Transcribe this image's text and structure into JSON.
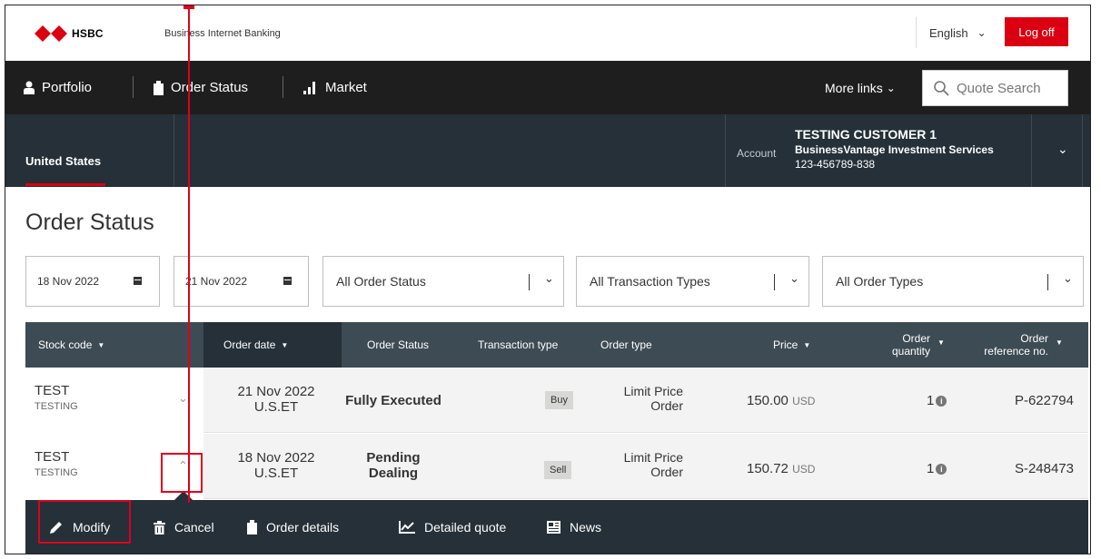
{
  "header": {
    "brand": "HSBC",
    "app_title": "Business Internet Banking",
    "language": "English",
    "logoff_label": "Log off"
  },
  "nav": {
    "items": [
      {
        "label": "Portfolio",
        "icon": "person-icon"
      },
      {
        "label": "Order Status",
        "icon": "clipboard-icon"
      },
      {
        "label": "Market",
        "icon": "bar-chart-icon"
      }
    ],
    "more_links": "More links",
    "quote_search_placeholder": "Quote Search"
  },
  "account": {
    "market_tab": "United States",
    "label": "Account",
    "customer": "TESTING CUSTOMER 1",
    "service": "BusinessVantage Investment Services",
    "number": "123-456789-838"
  },
  "page": {
    "title": "Order Status"
  },
  "filters": {
    "from_date": "18 Nov 2022",
    "to_date": "21 Nov 2022",
    "order_status": "All Order Status",
    "transaction_types": "All Transaction Types",
    "order_types": "All Order Types"
  },
  "table": {
    "headers": {
      "stock_code": "Stock code",
      "order_date": "Order date",
      "order_status": "Order Status",
      "transaction_type": "Transaction type",
      "order_type": "Order type",
      "price": "Price",
      "order_quantity_1": "Order",
      "order_quantity_2": "quantity",
      "order_ref_1": "Order",
      "order_ref_2": "reference no."
    },
    "rows": [
      {
        "stock_code": "TEST",
        "stock_name": "TESTING",
        "date_line1": "21 Nov 2022",
        "date_line2": "U.S.ET",
        "status_line1": "Fully Executed",
        "status_line2": "",
        "transaction": "Buy",
        "type_line1": "Limit Price",
        "type_line2": "Order",
        "price": "150.00",
        "currency": "USD",
        "quantity": "1",
        "reference": "P-622794"
      },
      {
        "stock_code": "TEST",
        "stock_name": "TESTING",
        "date_line1": "18 Nov 2022",
        "date_line2": "U.S.ET",
        "status_line1": "Pending",
        "status_line2": "Dealing",
        "transaction": "Sell",
        "type_line1": "Limit Price",
        "type_line2": "Order",
        "price": "150.72",
        "currency": "USD",
        "quantity": "1",
        "reference": "S-248473"
      }
    ]
  },
  "actions": {
    "modify": "Modify",
    "cancel": "Cancel",
    "order_details": "Order details",
    "detailed_quote": "Detailed quote",
    "news": "News"
  },
  "colors": {
    "brand_red": "#db0011",
    "nav_dark": "#1e1e1e",
    "account_bar": "#253038",
    "table_header": "#3d4b54",
    "annotation_red": "#e0001b"
  }
}
